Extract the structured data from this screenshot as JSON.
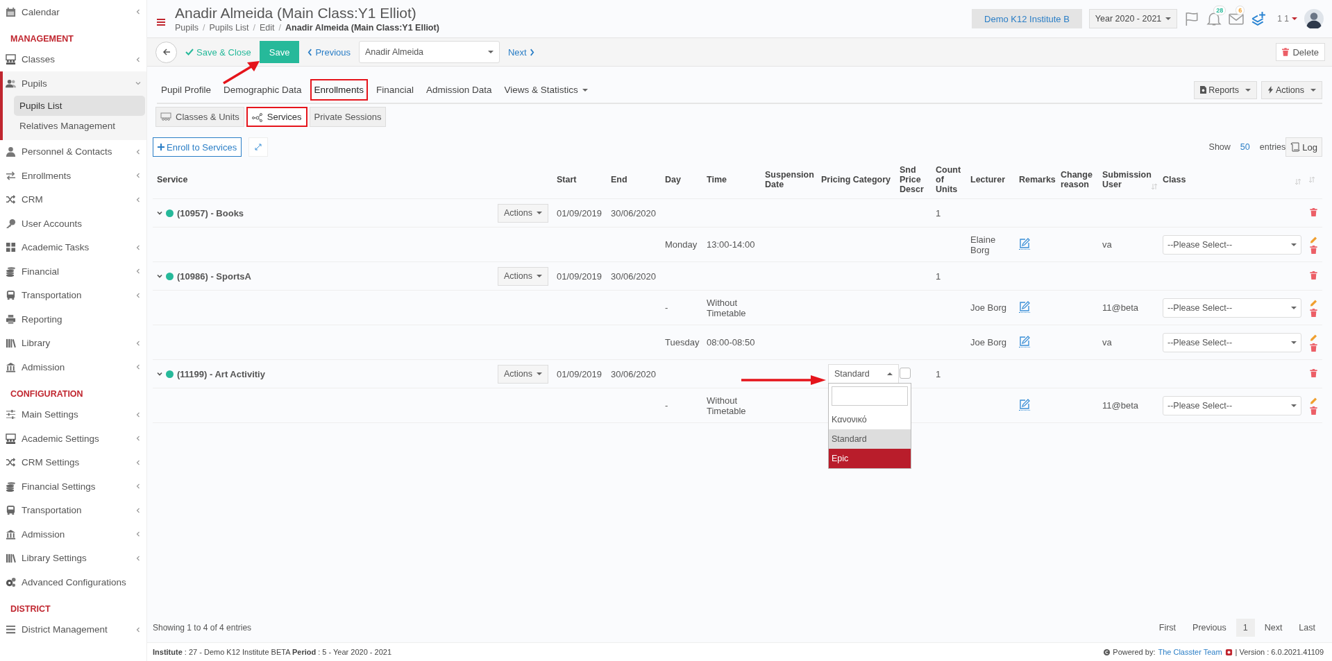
{
  "sidebar": {
    "sections": [
      {
        "items": [
          {
            "label": "Calendar",
            "has_submenu": true,
            "expanded": false
          }
        ]
      },
      {
        "heading": "MANAGEMENT",
        "items": [
          {
            "label": "Classes",
            "has_submenu": true,
            "expanded": false
          },
          {
            "label": "Pupils",
            "has_submenu": true,
            "expanded": true,
            "children": [
              {
                "label": "Pupils List",
                "selected": true
              },
              {
                "label": "Relatives Management",
                "selected": false
              }
            ]
          },
          {
            "label": "Personnel & Contacts",
            "has_submenu": true,
            "expanded": false
          },
          {
            "label": "Enrollments",
            "has_submenu": true,
            "expanded": false
          },
          {
            "label": "CRM",
            "has_submenu": true,
            "expanded": false
          },
          {
            "label": "User Accounts",
            "has_submenu": false,
            "expanded": false
          },
          {
            "label": "Academic Tasks",
            "has_submenu": true,
            "expanded": false
          },
          {
            "label": "Financial",
            "has_submenu": true,
            "expanded": false
          },
          {
            "label": "Transportation",
            "has_submenu": true,
            "expanded": false
          },
          {
            "label": "Reporting",
            "has_submenu": false,
            "expanded": false
          },
          {
            "label": "Library",
            "has_submenu": true,
            "expanded": false
          },
          {
            "label": "Admission",
            "has_submenu": true,
            "expanded": false
          }
        ]
      },
      {
        "heading": "CONFIGURATION",
        "items": [
          {
            "label": "Main Settings",
            "has_submenu": true,
            "expanded": false
          },
          {
            "label": "Academic Settings",
            "has_submenu": true,
            "expanded": false
          },
          {
            "label": "CRM Settings",
            "has_submenu": true,
            "expanded": false
          },
          {
            "label": "Financial Settings",
            "has_submenu": true,
            "expanded": false
          },
          {
            "label": "Transportation",
            "has_submenu": true,
            "expanded": false
          },
          {
            "label": "Admission",
            "has_submenu": true,
            "expanded": false
          },
          {
            "label": "Library Settings",
            "has_submenu": true,
            "expanded": false
          },
          {
            "label": "Advanced Configurations",
            "has_submenu": false,
            "expanded": false
          }
        ]
      },
      {
        "heading": "DISTRICT",
        "items": [
          {
            "label": "District Management",
            "has_submenu": true,
            "expanded": false
          }
        ]
      }
    ]
  },
  "header": {
    "title": "Anadir Almeida (Main Class:Y1 Elliot)",
    "breadcrumb": [
      {
        "label": "Pupils",
        "current": false
      },
      {
        "label": "Pupils List",
        "current": false
      },
      {
        "label": "Edit",
        "current": false
      },
      {
        "label": "Anadir Almeida (Main Class:Y1 Elliot)",
        "current": true
      }
    ],
    "breadcrumb_separator": "/",
    "institute": "Demo K12 Institute B",
    "year": "Year 2020 - 2021",
    "notifications": "28",
    "messages": "6",
    "user": "1 1"
  },
  "toolbar": {
    "save_close": "Save & Close",
    "save": "Save",
    "previous": "Previous",
    "pupil": "Anadir Almeida",
    "next": "Next",
    "delete": "Delete"
  },
  "tabs": [
    {
      "label": "Pupil Profile",
      "selected": false,
      "annotated": false,
      "dropdown": false
    },
    {
      "label": "Demographic Data",
      "selected": false,
      "annotated": false,
      "dropdown": false
    },
    {
      "label": "Enrollments",
      "selected": true,
      "annotated": true,
      "dropdown": false
    },
    {
      "label": "Financial",
      "selected": false,
      "annotated": false,
      "dropdown": false
    },
    {
      "label": "Admission Data",
      "selected": false,
      "annotated": false,
      "dropdown": false
    },
    {
      "label": "Views & Statistics",
      "selected": false,
      "annotated": false,
      "dropdown": true
    }
  ],
  "tab_buttons": [
    "Reports",
    "Actions"
  ],
  "subtabs": [
    {
      "label": "Classes & Units",
      "selected": false,
      "annotated": false
    },
    {
      "label": "Services",
      "selected": true,
      "annotated": true
    },
    {
      "label": "Private Sessions",
      "selected": false,
      "annotated": false
    }
  ],
  "enroll_button": "Enroll to Services",
  "length": {
    "show": "Show",
    "value": "50",
    "entries": "entries"
  },
  "log_button": "Log",
  "table": {
    "columns": [
      "Service",
      "Start",
      "End",
      "Day",
      "Time",
      "Suspension Date",
      "Pricing Category",
      "Snd Price Descr",
      "Count of Units",
      "Lecturer",
      "Remarks",
      "Change reason",
      "Submission User",
      "Class"
    ],
    "services": [
      {
        "name": "(10957) - Books",
        "color": "#26b99a",
        "expanded": true,
        "actions": "Actions",
        "start": "01/09/2019",
        "end": "30/06/2020",
        "count": "1",
        "schedules": [
          {
            "day": "Monday",
            "time": "13:00-14:00",
            "lecturer": "Elaine Borg",
            "user": "va",
            "class": "--Please Select--"
          }
        ]
      },
      {
        "name": "(10986) - SportsA",
        "color": "#26b99a",
        "expanded": true,
        "actions": "Actions",
        "start": "01/09/2019",
        "end": "30/06/2020",
        "count": "1",
        "schedules": [
          {
            "day": "-",
            "time": "Without Timetable",
            "lecturer": "Joe Borg",
            "user": "11@beta",
            "class": "--Please Select--"
          },
          {
            "day": "Tuesday",
            "time": "08:00-08:50",
            "lecturer": "Joe Borg",
            "user": "va",
            "class": "--Please Select--"
          }
        ]
      },
      {
        "name": "(11199) - Art Activitiy",
        "color": "#26b99a",
        "expanded": true,
        "actions": "Actions",
        "start": "01/09/2019",
        "end": "30/06/2020",
        "count": "1",
        "pricing": {
          "value": "Standard",
          "open": true,
          "options": [
            {
              "label": "Κανονικό",
              "selected": false,
              "highlighted": false
            },
            {
              "label": "Standard",
              "selected": true,
              "highlighted": false
            },
            {
              "label": "Epic",
              "selected": false,
              "highlighted": true
            }
          ]
        },
        "snd_checked": false,
        "schedules": [
          {
            "day": "-",
            "time": "Without Timetable",
            "user": "11@beta",
            "class": "--Please Select--"
          }
        ]
      }
    ]
  },
  "info": "Showing 1 to 4 of 4 entries",
  "pagination": [
    {
      "label": "First",
      "selected": false
    },
    {
      "label": "Previous",
      "selected": false
    },
    {
      "label": "1",
      "selected": true
    },
    {
      "label": "Next",
      "selected": false
    },
    {
      "label": "Last",
      "selected": false
    }
  ],
  "footer": {
    "left": "**Institute** : 27 - Demo K12 Institute BETA **Period** : 5 - Year 2020 - 2021",
    "powered": "Powered by:",
    "team": "The Classter Team",
    "version": "| Version : 6.0.2021.41109"
  }
}
